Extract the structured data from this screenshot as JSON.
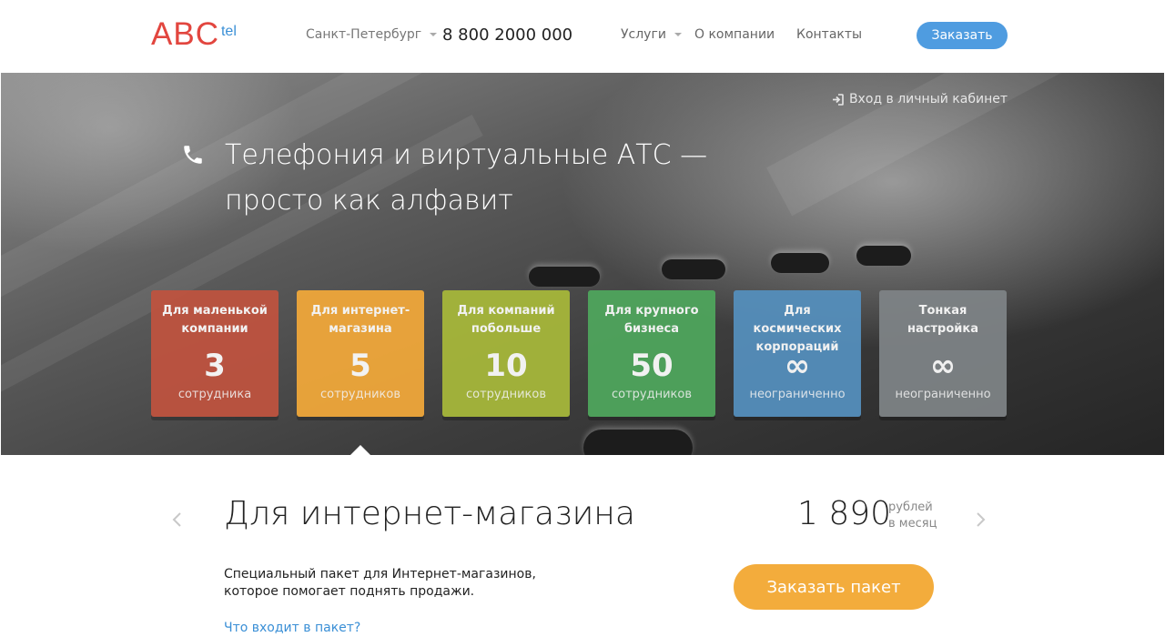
{
  "header": {
    "logo_main": "ABC",
    "logo_sub": "tel",
    "city": "Санкт-Петербург",
    "phone": "8 800 2000 000",
    "nav": [
      {
        "label": "Услуги"
      },
      {
        "label": "О компании"
      },
      {
        "label": "Контакты"
      }
    ],
    "order_label": "Заказать"
  },
  "hero": {
    "login_label": "Вход в личный кабинет",
    "title_line1": "Телефония и виртуальные АТС —",
    "title_line2": "просто как алфавит",
    "cards": [
      {
        "title": "Для маленькой компании",
        "value": "3",
        "unit": "сотрудника",
        "color": "#c0533f"
      },
      {
        "title": "Для интернет-магазина",
        "value": "5",
        "unit": "сотрудников",
        "color": "#f3a93a"
      },
      {
        "title": "Для компаний побольше",
        "value": "10",
        "unit": "сотрудников",
        "color": "#a8b93a"
      },
      {
        "title": "Для крупного бизнеса",
        "value": "50",
        "unit": "сотрудников",
        "color": "#4fa75d"
      },
      {
        "title": "Для космических корпораций",
        "value": "∞",
        "unit": "неограниченно",
        "color": "#5590be"
      },
      {
        "title": "Тонкая настройка",
        "value": "∞",
        "unit": "неограниченно",
        "color": "#7f8487"
      }
    ]
  },
  "package": {
    "title": "Для интернет-магазина",
    "price": "1 890",
    "price_unit_line1": "рублей",
    "price_unit_line2": "в месяц",
    "desc_line1": "Специальный пакет для Интернет-магазинов,",
    "desc_line2": "которое помогает поднять продажи.",
    "order_label": "Заказать пакет",
    "whats_in_label": "Что входит в пакет?"
  },
  "colors": {
    "brand_red": "#e2463f",
    "brand_blue": "#4f9ce0",
    "accent_orange": "#f3ac3c"
  }
}
